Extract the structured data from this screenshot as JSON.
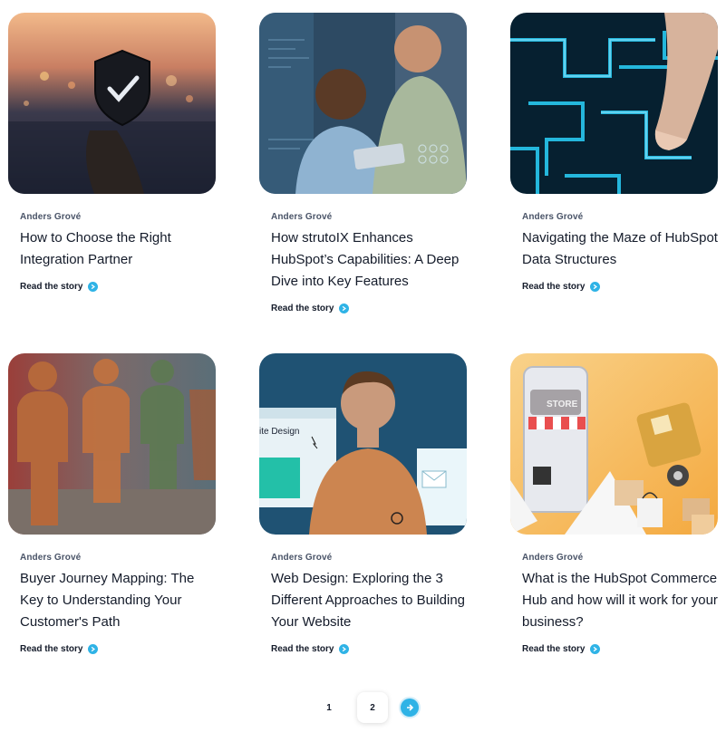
{
  "read_label": "Read the story",
  "cards": [
    {
      "author": "Anders Grové",
      "title": "How to Choose the Right Integration Partner",
      "image": "security-shield-image"
    },
    {
      "author": "Anders Grové",
      "title": "How strutoIX Enhances HubSpot’s Capabilities: A Deep Dive into Key Features",
      "image": "two-men-tablet-image"
    },
    {
      "author": "Anders Grové",
      "title": "Navigating the Maze of HubSpot Data Structures",
      "image": "digital-maze-image"
    },
    {
      "author": "Anders Grové",
      "title": "Buyer Journey Mapping: The Key to Understanding Your Customer's Path",
      "image": "wooden-figures-image"
    },
    {
      "author": "Anders Grové",
      "title": "Web Design: Exploring the 3 Different Approaches to Building Your Website",
      "image": "man-web-design-image",
      "image_text": "ite Design"
    },
    {
      "author": "Anders Grové",
      "title": "What is the HubSpot Commerce Hub and how will it work for your business?",
      "image": "store-delivery-image",
      "image_text": "STORE"
    }
  ],
  "pagination": {
    "pages": [
      "1",
      "2"
    ],
    "current": "2"
  },
  "colors": {
    "accent": "#2fb3e6",
    "text": "#141b2a",
    "author": "#4a5468"
  }
}
